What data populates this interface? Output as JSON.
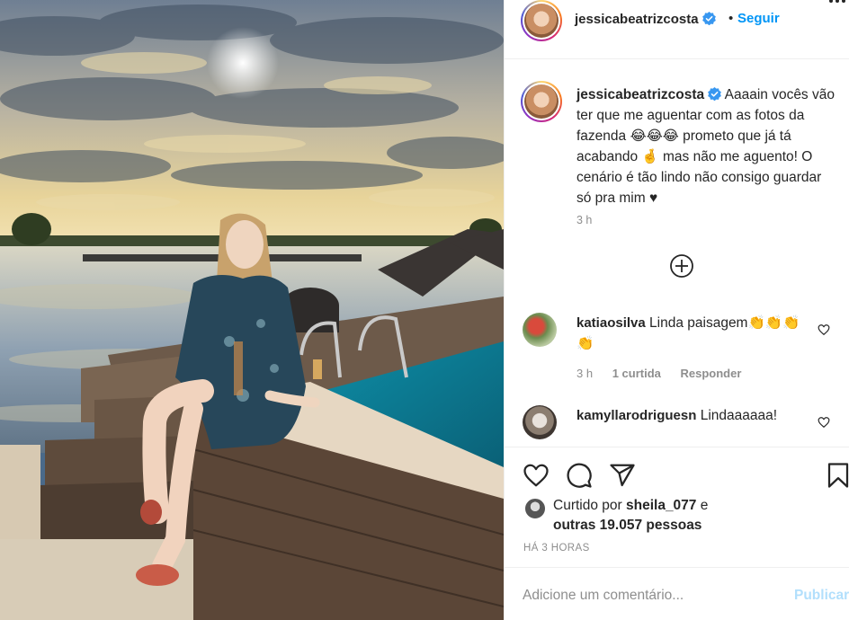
{
  "post": {
    "author": "jessicabeatrizcosta",
    "follow_label": "Seguir",
    "separator": "•",
    "photo_alt": "Mulher sentada na borda da piscina com lago e céu ao entardecer"
  },
  "caption": {
    "username": "jessicabeatrizcosta",
    "text": "Aaaain vocês vão ter que me aguentar com as fotos da fazenda 😂😂😂 prometo que já tá acabando 🤞 mas não me aguento! O cenário é tão lindo não consigo guardar só pra mim ♥",
    "time": "3 h"
  },
  "comments": [
    {
      "username": "katiaosilva",
      "text": "Linda paisagem👏👏👏👏",
      "time": "3 h",
      "likes": "1 curtida",
      "reply_label": "Responder"
    },
    {
      "username": "kamyllarodriguesn",
      "text": "Lindaaaaaa!"
    }
  ],
  "likes": {
    "prefix": "Curtido por",
    "user": "sheila_077",
    "connector": "e",
    "others": "outras 19.057 pessoas"
  },
  "post_time": "HÁ 3 HORAS",
  "add_comment": {
    "placeholder": "Adicione um comentário...",
    "publish_label": "Publicar"
  },
  "colors": {
    "accent": "#0095f6",
    "publish_disabled": "#b2dffc",
    "muted": "#8e8e8e",
    "text": "#262626"
  },
  "icons": [
    "verified-badge-icon",
    "more-options-icon",
    "load-more-comments-icon",
    "heart-icon",
    "comment-icon",
    "share-icon",
    "bookmark-icon"
  ]
}
